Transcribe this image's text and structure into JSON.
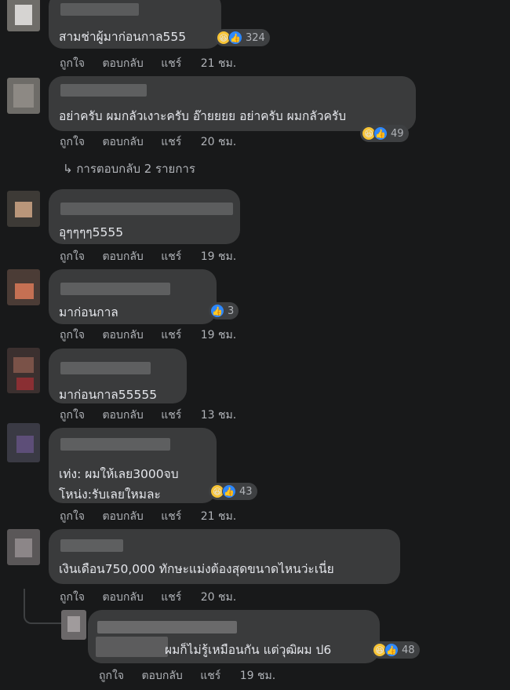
{
  "actions": {
    "like": "ถูกใจ",
    "reply": "ตอบกลับ",
    "share": "แชร์"
  },
  "comments": [
    {
      "text": "สามช่าผู้มาก่อนกาล555",
      "time": "21 ชม.",
      "reactions": "324"
    },
    {
      "text": "อย่าครับ ผมกลัวเงาะครับ อ๊ายยยย อย่าครับ ผมกลัวครับ",
      "time": "20 ชม.",
      "reactions": "49",
      "replies": "การตอบกลับ 2 รายการ"
    },
    {
      "text": "อุๆๆๆๆ5555",
      "time": "19 ชม."
    },
    {
      "text": "มาก่อนกาล",
      "time": "19 ชม.",
      "reactions": "3"
    },
    {
      "text": "มาก่อนกาล55555",
      "time": "13 ชม."
    },
    {
      "text": "เท่ง: ผมให้เลย3000จบ",
      "text2": "โหน่ง:รับเลยใหมละ",
      "time": "21 ชม.",
      "reactions": "43"
    },
    {
      "text": "เงินเดือน750,000 ทักษะแม่งต้องสุดขนาดไหนว่ะเนี่ย",
      "time": "20 ชม."
    },
    {
      "text": "ผมก็ไม่รู้เหมือนกัน แต่วุฒิผม ป6",
      "time": "19 ชม.",
      "reactions": "48"
    }
  ],
  "icons": {
    "haha": "haha-emoji-icon",
    "like": "like-thumb-icon",
    "reply_arrow": "reply-arrow-icon"
  },
  "colors": {
    "bubble": "#3a3b3c",
    "background": "#18191a",
    "like_blue": "#2d88ff",
    "haha_yellow": "#f7c436"
  }
}
